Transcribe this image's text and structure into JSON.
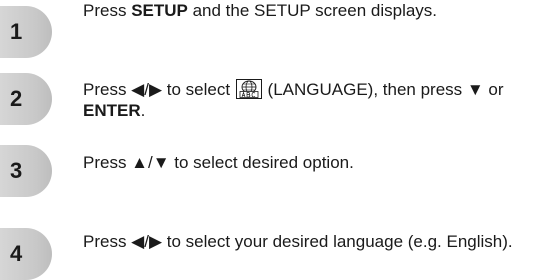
{
  "steps": [
    {
      "number": "1",
      "parts": {
        "pre": "Press ",
        "bold1": "SETUP",
        "post": " and the SETUP screen displays."
      }
    },
    {
      "number": "2",
      "parts": {
        "pre": "Press ◀/▶ to select ",
        "icon": "language-globe-icon",
        "mid": " (LANGUAGE), then press ▼ or ",
        "bold1": "ENTER",
        "post": "."
      }
    },
    {
      "number": "3",
      "parts": {
        "text": "Press ▲/▼ to select desired option."
      }
    },
    {
      "number": "4",
      "parts": {
        "text": "Press ◀/▶ to select your desired language (e.g. English)."
      }
    }
  ]
}
